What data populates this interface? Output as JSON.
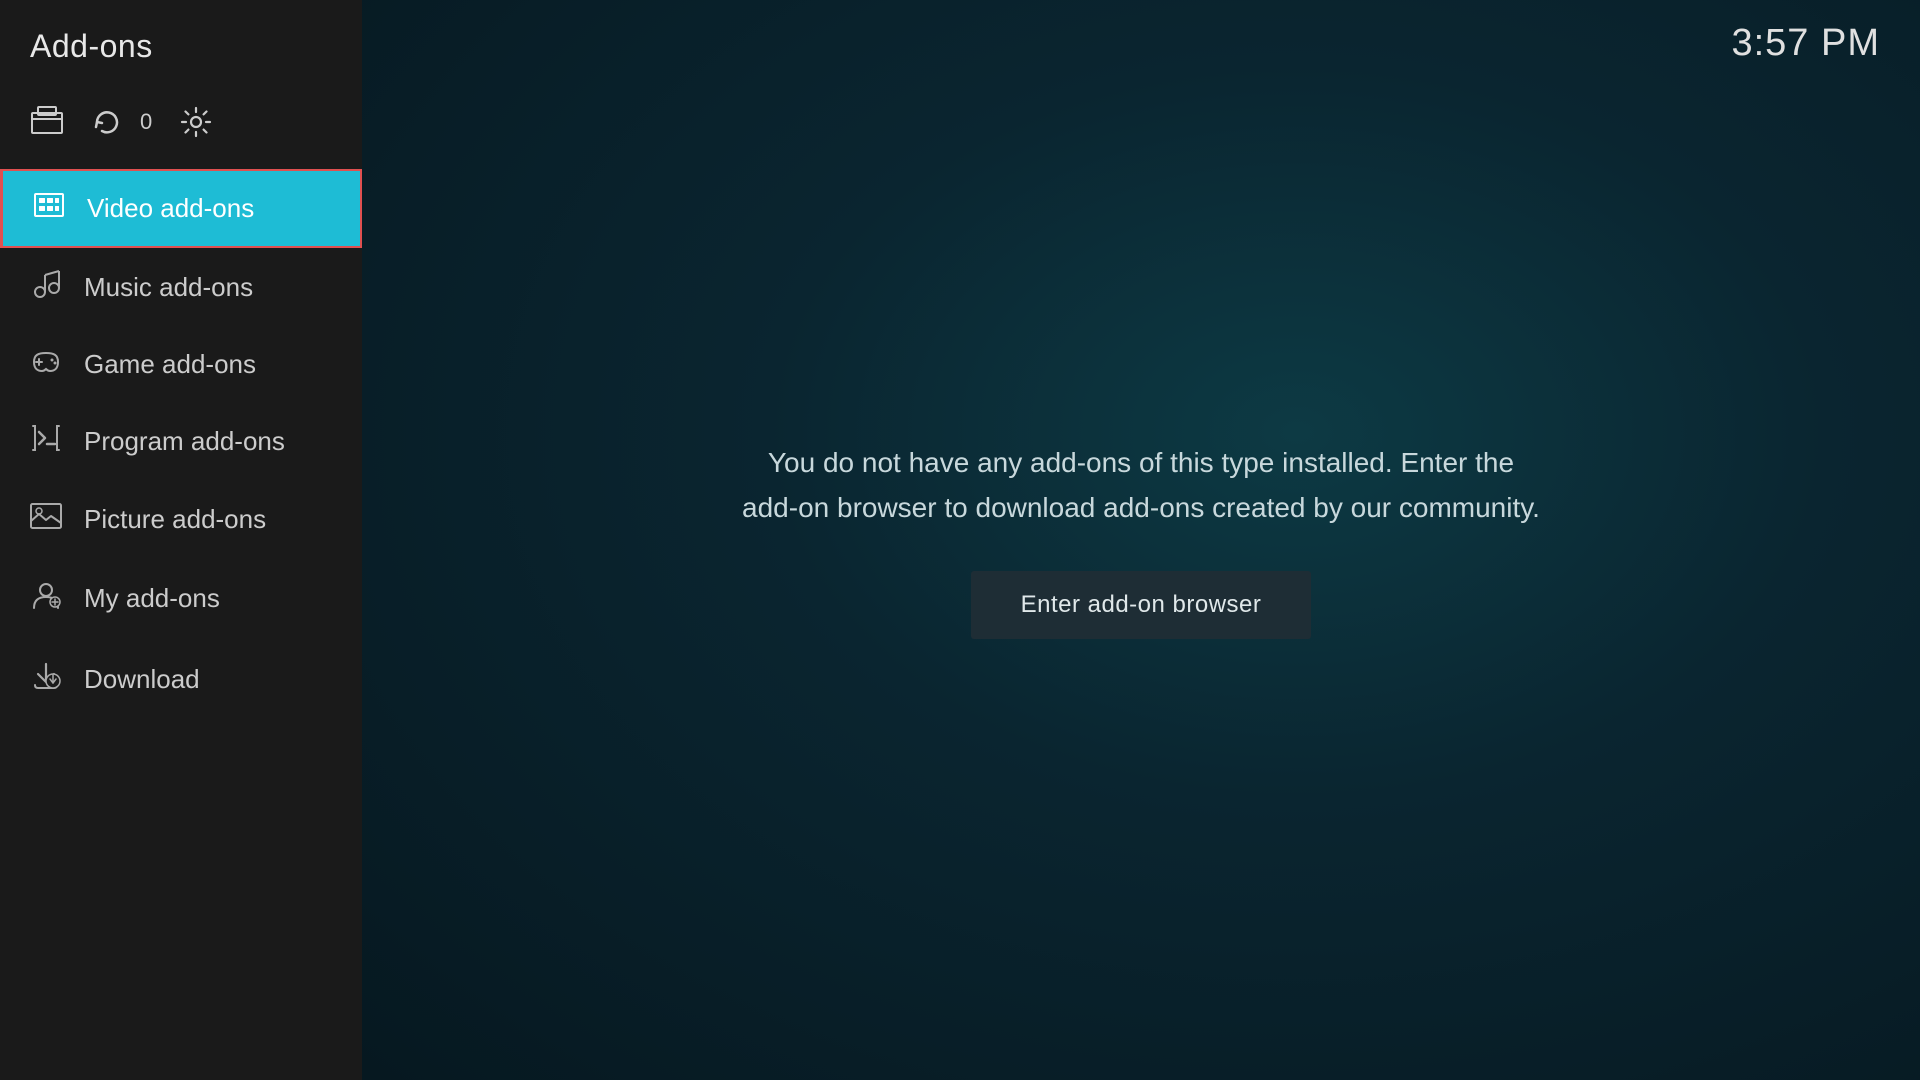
{
  "app": {
    "title": "Add-ons",
    "time": "3:57 PM"
  },
  "toolbar": {
    "update_count": "0"
  },
  "nav": {
    "items": [
      {
        "id": "video-addons",
        "label": "Video add-ons",
        "active": true
      },
      {
        "id": "music-addons",
        "label": "Music add-ons",
        "active": false
      },
      {
        "id": "game-addons",
        "label": "Game add-ons",
        "active": false
      },
      {
        "id": "program-addons",
        "label": "Program add-ons",
        "active": false
      },
      {
        "id": "picture-addons",
        "label": "Picture add-ons",
        "active": false
      },
      {
        "id": "my-addons",
        "label": "My add-ons",
        "active": false
      },
      {
        "id": "download",
        "label": "Download",
        "active": false
      }
    ]
  },
  "main": {
    "empty_message": "You do not have any add-ons of this type installed. Enter the add-on browser to download add-ons created by our community.",
    "enter_browser_label": "Enter add-on browser"
  }
}
